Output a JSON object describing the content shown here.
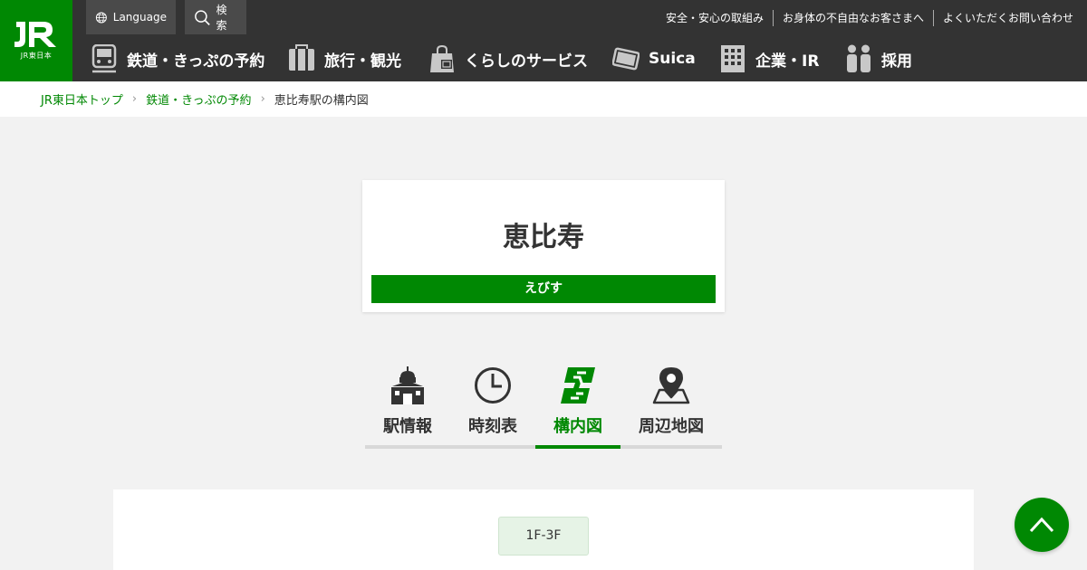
{
  "header": {
    "logo_sub": "JR東日本",
    "language_label": "Language",
    "search_label": "検索",
    "top_links": [
      "安全・安心の取組み",
      "お身体の不自由なお客さまへ",
      "よくいただくお問い合わせ"
    ],
    "nav": [
      {
        "label": "鉄道・きっぷの予約",
        "icon": "train-icon"
      },
      {
        "label": "旅行・観光",
        "icon": "suitcase-icon"
      },
      {
        "label": "くらしのサービス",
        "icon": "shopping-bag-icon"
      },
      {
        "label": "Suica",
        "icon": "suica-card-icon"
      },
      {
        "label": "企業・IR",
        "icon": "building-icon"
      },
      {
        "label": "採用",
        "icon": "people-icon"
      }
    ]
  },
  "breadcrumb": {
    "items": [
      "JR東日本トップ",
      "鉄道・きっぷの予約"
    ],
    "current": "恵比寿駅の構内図"
  },
  "station": {
    "name": "恵比寿",
    "kana": "えびす"
  },
  "tabs": [
    {
      "label": "駅情報",
      "icon": "station-icon",
      "active": false
    },
    {
      "label": "時刻表",
      "icon": "clock-icon",
      "active": false
    },
    {
      "label": "構内図",
      "icon": "floor-map-icon",
      "active": true
    },
    {
      "label": "周辺地図",
      "icon": "map-pin-icon",
      "active": false
    }
  ],
  "floors": {
    "selected": "1F-3F"
  },
  "colors": {
    "brand": "#008803",
    "header_bg": "#333333",
    "page_bg": "#f2f2f2"
  }
}
